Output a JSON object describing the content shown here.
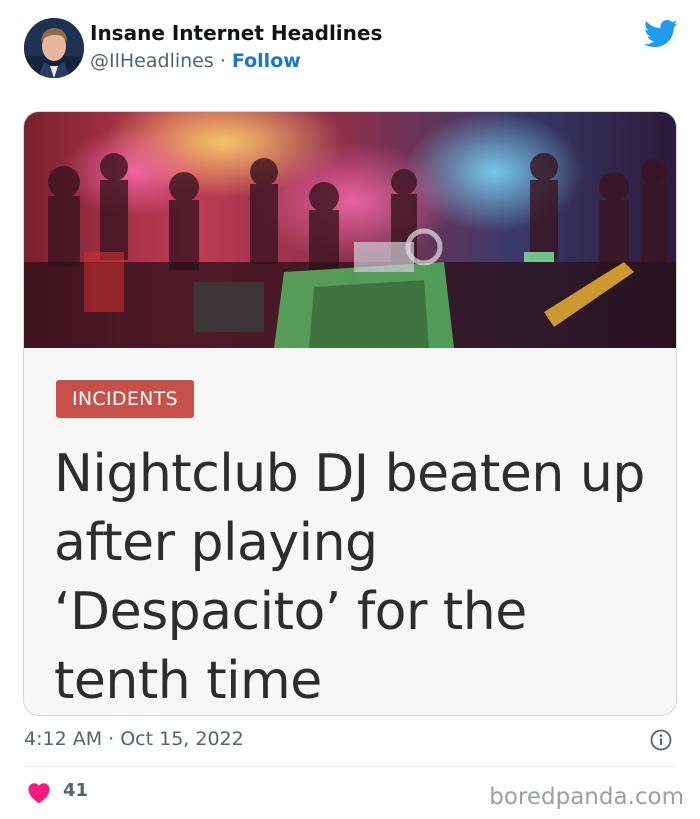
{
  "tweet": {
    "author_name": "Insane Internet Headlines",
    "handle": "@IlHeadlines",
    "separator": "·",
    "follow_label": "Follow",
    "timestamp": "4:12 AM · Oct 15, 2022",
    "like_count": "41"
  },
  "article": {
    "category": "INCIDENTS",
    "headline": "Nightclub DJ beaten up after playing ‘Despacito’ for the tenth time"
  },
  "watermark": "boredpanda.com",
  "colors": {
    "follow": "#1d74c8",
    "twitter_blue": "#1d9bf0",
    "heart": "#f91880",
    "tag_background": "#c8504b"
  },
  "icons": {
    "logo": "twitter-bird-icon",
    "info": "info-icon",
    "like": "heart-icon"
  }
}
